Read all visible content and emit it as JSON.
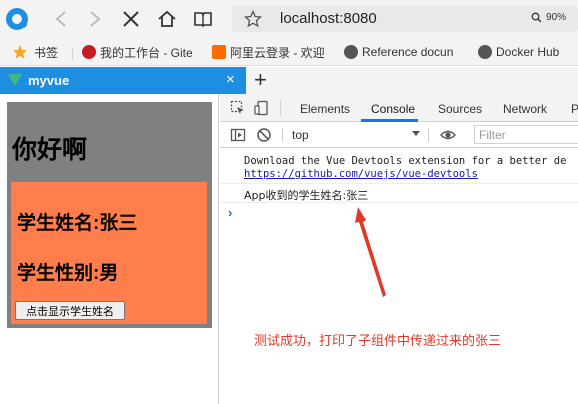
{
  "browser": {
    "url": "localhost:8080",
    "zoom": "90%"
  },
  "bookmarks": [
    {
      "label": "书签",
      "icon": "star-icon",
      "color": "#f5a623"
    },
    {
      "label": "我的工作台 - Gite",
      "icon": "gitee-icon",
      "color": "#c71d23"
    },
    {
      "label": "阿里云登录 - 欢迎",
      "icon": "aliyun-icon",
      "color": "#ff6a00"
    },
    {
      "label": "Reference docun",
      "icon": "docker-icon",
      "color": "#555555"
    },
    {
      "label": "Docker Hub",
      "icon": "docker-icon",
      "color": "#555555"
    }
  ],
  "tab": {
    "title": "myvue",
    "close": "×",
    "new_tab": "+"
  },
  "page": {
    "greeting": "你好啊",
    "student_name": "学生姓名:张三",
    "student_sex": "学生性别:男",
    "button_label": "点击显示学生姓名"
  },
  "devtools": {
    "tabs": [
      "Elements",
      "Console",
      "Sources",
      "Network",
      "P"
    ],
    "active_tab": "Console",
    "context": "top",
    "filter_placeholder": "Filter",
    "messages": {
      "devtools_line1": "Download the Vue Devtools extension for a better de",
      "devtools_link": "https://github.com/vuejs/vue-devtools",
      "log": "App收到的学生姓名:张三"
    },
    "prompt": "›"
  },
  "annotation": "测试成功，打印了子组件中传递过来的张三",
  "colors": {
    "accent": "#1e8fe0",
    "app_bg": "#808080",
    "child_bg": "#ff7e4b",
    "annotation": "#e03a2a"
  }
}
